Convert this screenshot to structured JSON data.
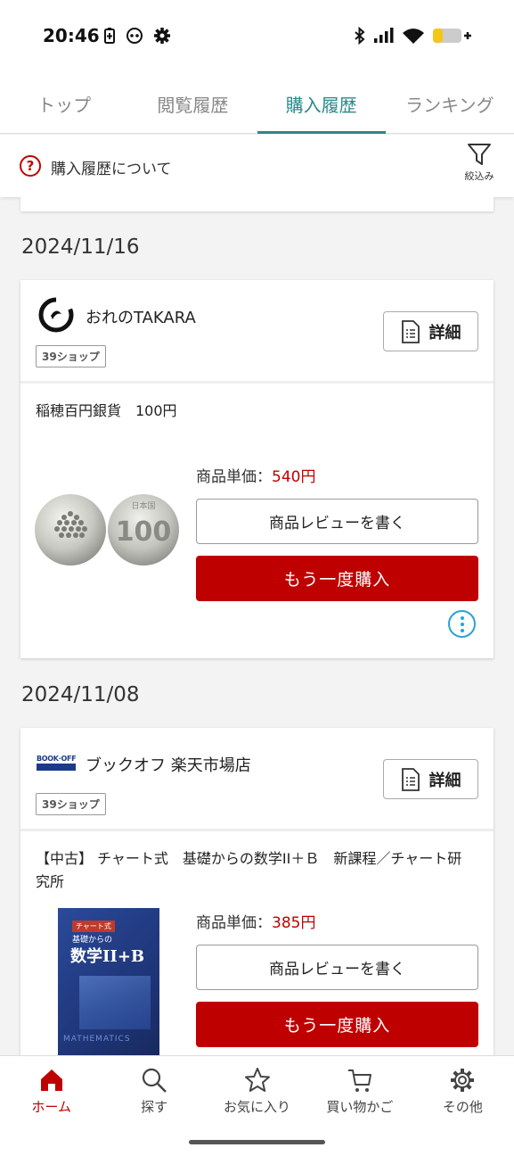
{
  "status_bar": {
    "time": "20:46"
  },
  "tabs": [
    {
      "label": "トップ",
      "active": false
    },
    {
      "label": "閲覧履歴",
      "active": false
    },
    {
      "label": "購入履歴",
      "active": true
    },
    {
      "label": "ランキング",
      "active": false
    }
  ],
  "info_bar": {
    "text": "購入履歴について",
    "filter_label": "絞込み"
  },
  "orders": [
    {
      "date": "2024/11/16",
      "shop_name": "おれのTAKARA",
      "badge": "39ショップ",
      "detail_label": "詳細",
      "item_title": "稲穂百円銀貨　100円",
      "price_label": "商品単価：",
      "price": "540円",
      "review_label": "商品レビューを書く",
      "rebuy_label": "もう一度購入"
    },
    {
      "date": "2024/11/08",
      "shop_name": "ブックオフ 楽天市場店",
      "shop_logo_text": "BOOK·OFF",
      "badge": "39ショップ",
      "detail_label": "詳細",
      "item_title": "【中古】 チャート式　基礎からの数学II＋Ｂ　新課程／チャート研究所",
      "price_label": "商品単価：",
      "price": "385円",
      "review_label": "商品レビューを書く",
      "rebuy_label": "もう一度購入",
      "book_cover_text": {
        "series": "チャート式",
        "subtitle": "基礎からの",
        "title": "数学II+B",
        "footer": "MATHEMATICS"
      }
    }
  ],
  "bottom_nav": [
    {
      "label": "ホーム",
      "icon": "home-icon",
      "active": true
    },
    {
      "label": "探す",
      "icon": "search-icon",
      "active": false
    },
    {
      "label": "お気に入り",
      "icon": "star-icon",
      "active": false
    },
    {
      "label": "買い物かご",
      "icon": "cart-icon",
      "active": false
    },
    {
      "label": "その他",
      "icon": "gear-icon",
      "active": false
    }
  ],
  "colors": {
    "accent_red": "#bf0000",
    "tab_active": "#2a8a8a",
    "more_blue": "#29a3d6"
  }
}
